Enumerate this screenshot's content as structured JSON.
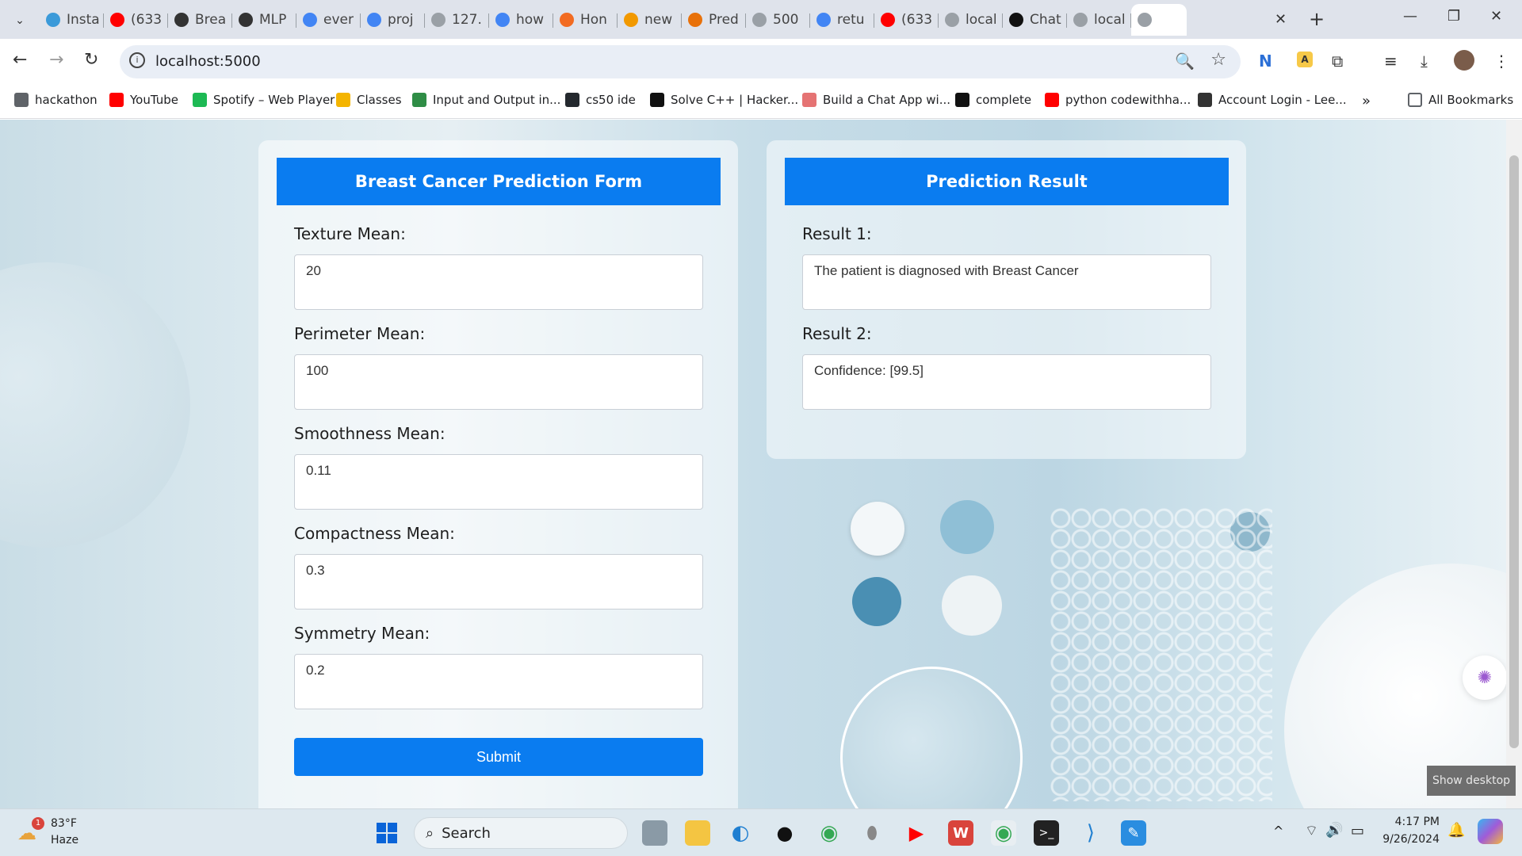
{
  "browser": {
    "tabs": [
      {
        "label": "Insta",
        "icon": "python-icon",
        "color": "#3b9ad9"
      },
      {
        "label": "(633",
        "icon": "youtube-icon",
        "color": "#ff0000"
      },
      {
        "label": "Brea",
        "icon": "github-icon",
        "color": "#333333"
      },
      {
        "label": "MLP",
        "icon": "github-icon",
        "color": "#333333"
      },
      {
        "label": "ever",
        "icon": "google-icon",
        "color": "#4285f4"
      },
      {
        "label": "proj",
        "icon": "google-icon",
        "color": "#4285f4"
      },
      {
        "label": "127.",
        "icon": "globe-icon",
        "color": "#9aa0a6"
      },
      {
        "label": "how",
        "icon": "google-icon",
        "color": "#4285f4"
      },
      {
        "label": "Hon",
        "icon": "arc-icon",
        "color": "#f26b21"
      },
      {
        "label": "new",
        "icon": "document-icon",
        "color": "#f29900"
      },
      {
        "label": "Pred",
        "icon": "notes-icon",
        "color": "#e8710a"
      },
      {
        "label": "500",
        "icon": "globe-icon",
        "color": "#9aa0a6"
      },
      {
        "label": "retu",
        "icon": "google-icon",
        "color": "#4285f4"
      },
      {
        "label": "(633",
        "icon": "youtube-icon",
        "color": "#ff0000"
      },
      {
        "label": "local",
        "icon": "globe-icon",
        "color": "#9aa0a6"
      },
      {
        "label": "Chat",
        "icon": "chatgpt-icon",
        "color": "#111111"
      },
      {
        "label": "local",
        "icon": "globe-icon",
        "color": "#9aa0a6"
      }
    ],
    "active_tab_label": "",
    "new_tab": "+",
    "url": "localhost:5000",
    "bookmarks": [
      {
        "label": "hackathon",
        "icon": "folder-icon",
        "color": "#5f6368"
      },
      {
        "label": "YouTube",
        "icon": "youtube-icon",
        "color": "#ff0000"
      },
      {
        "label": "Spotify – Web Player",
        "icon": "spotify-icon",
        "color": "#1db954"
      },
      {
        "label": "Classes",
        "icon": "classroom-icon",
        "color": "#f4b400"
      },
      {
        "label": "Input and Output in...",
        "icon": "gfg-icon",
        "color": "#2f8d46"
      },
      {
        "label": "cs50 ide",
        "icon": "github-icon",
        "color": "#24292e"
      },
      {
        "label": "Solve C++ | Hacker...",
        "icon": "hackerrank-icon",
        "color": "#111111"
      },
      {
        "label": "Build a Chat App wi...",
        "icon": "pen-icon",
        "color": "#e57373"
      },
      {
        "label": "complete",
        "icon": "code-icon",
        "color": "#111111"
      },
      {
        "label": "python codewithha...",
        "icon": "youtube-icon",
        "color": "#ff0000"
      },
      {
        "label": "Account Login - Lee...",
        "icon": "leetcode-icon",
        "color": "#333333"
      }
    ],
    "bookmarks_overflow": "»",
    "all_bookmarks": "All Bookmarks"
  },
  "form": {
    "title": "Breast Cancer Prediction Form",
    "fields": [
      {
        "label": "Texture Mean:",
        "value": "20"
      },
      {
        "label": "Perimeter Mean:",
        "value": "100"
      },
      {
        "label": "Smoothness Mean:",
        "value": "0.11"
      },
      {
        "label": "Compactness Mean:",
        "value": "0.3"
      },
      {
        "label": "Symmetry Mean:",
        "value": "0.2"
      }
    ],
    "submit": "Submit"
  },
  "result": {
    "title": "Prediction Result",
    "items": [
      {
        "label": "Result 1:",
        "value": "The patient is diagnosed with Breast Cancer"
      },
      {
        "label": "Result 2:",
        "value": "Confidence: [99.5]"
      }
    ]
  },
  "show_desktop": "Show desktop",
  "taskbar": {
    "weather_temp": "83°F",
    "weather_desc": "Haze",
    "weather_badge": "1",
    "search_label": "Search",
    "time": "4:17 PM",
    "date": "9/26/2024"
  }
}
